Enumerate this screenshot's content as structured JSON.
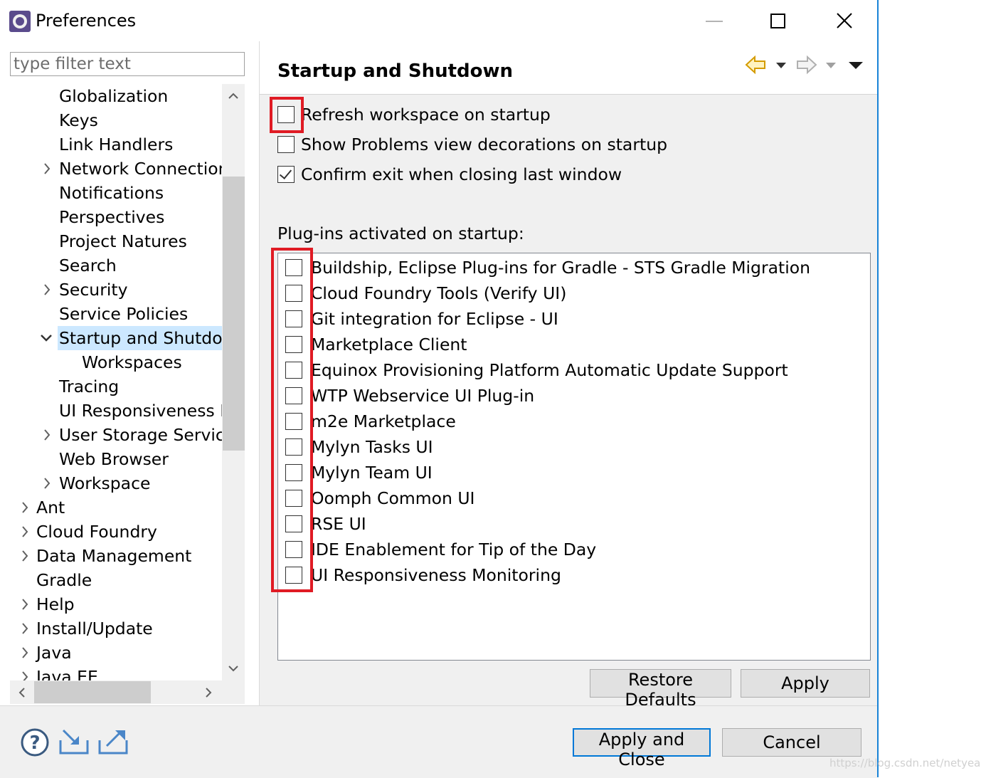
{
  "window": {
    "title": "Preferences",
    "minimize_icon": "minimize-icon",
    "maximize_icon": "maximize-icon",
    "close_icon": "close-icon"
  },
  "filter": {
    "placeholder": "type filter text",
    "value": ""
  },
  "tree": {
    "items": [
      {
        "label": "Globalization",
        "level": 1,
        "expander": "none"
      },
      {
        "label": "Keys",
        "level": 1,
        "expander": "none"
      },
      {
        "label": "Link Handlers",
        "level": 1,
        "expander": "none"
      },
      {
        "label": "Network Connection",
        "level": 1,
        "expander": "collapsed"
      },
      {
        "label": "Notifications",
        "level": 1,
        "expander": "none"
      },
      {
        "label": "Perspectives",
        "level": 1,
        "expander": "none"
      },
      {
        "label": "Project Natures",
        "level": 1,
        "expander": "none"
      },
      {
        "label": "Search",
        "level": 1,
        "expander": "none"
      },
      {
        "label": "Security",
        "level": 1,
        "expander": "collapsed"
      },
      {
        "label": "Service Policies",
        "level": 1,
        "expander": "none"
      },
      {
        "label": "Startup and Shutdown",
        "level": 1,
        "expander": "expanded",
        "selected": true
      },
      {
        "label": "Workspaces",
        "level": 2,
        "expander": "none"
      },
      {
        "label": "Tracing",
        "level": 1,
        "expander": "none"
      },
      {
        "label": "UI Responsiveness M",
        "level": 1,
        "expander": "none"
      },
      {
        "label": "User Storage Service",
        "level": 1,
        "expander": "collapsed"
      },
      {
        "label": "Web Browser",
        "level": 1,
        "expander": "none"
      },
      {
        "label": "Workspace",
        "level": 1,
        "expander": "collapsed"
      },
      {
        "label": "Ant",
        "level": 0,
        "expander": "collapsed"
      },
      {
        "label": "Cloud Foundry",
        "level": 0,
        "expander": "collapsed"
      },
      {
        "label": "Data Management",
        "level": 0,
        "expander": "collapsed"
      },
      {
        "label": "Gradle",
        "level": 0,
        "expander": "none"
      },
      {
        "label": "Help",
        "level": 0,
        "expander": "collapsed"
      },
      {
        "label": "Install/Update",
        "level": 0,
        "expander": "collapsed"
      },
      {
        "label": "Java",
        "level": 0,
        "expander": "collapsed"
      },
      {
        "label": "Java EE",
        "level": 0,
        "expander": "collapsed"
      }
    ]
  },
  "page": {
    "title": "Startup and Shutdown",
    "back_icon": "back-arrow-icon",
    "forward_icon": "forward-arrow-icon",
    "menu_icon": "view-menu-icon",
    "options": [
      {
        "label": "Refresh workspace on startup",
        "checked": false
      },
      {
        "label": "Show Problems view decorations on startup",
        "checked": false
      },
      {
        "label": "Confirm exit when closing last window",
        "checked": true
      }
    ],
    "plugins_label": "Plug-ins activated on startup:",
    "plugins": [
      {
        "label": "Buildship, Eclipse Plug-ins for Gradle - STS Gradle Migration",
        "checked": false
      },
      {
        "label": "Cloud Foundry Tools (Verify UI)",
        "checked": false
      },
      {
        "label": "Git integration for Eclipse - UI",
        "checked": false
      },
      {
        "label": "Marketplace Client",
        "checked": false
      },
      {
        "label": "Equinox Provisioning Platform Automatic Update Support",
        "checked": false
      },
      {
        "label": "WTP Webservice UI Plug-in",
        "checked": false
      },
      {
        "label": "m2e Marketplace",
        "checked": false
      },
      {
        "label": "Mylyn Tasks UI",
        "checked": false
      },
      {
        "label": "Mylyn Team UI",
        "checked": false
      },
      {
        "label": "Oomph Common UI",
        "checked": false
      },
      {
        "label": "RSE UI",
        "checked": false
      },
      {
        "label": "IDE Enablement for Tip of the Day",
        "checked": false
      },
      {
        "label": "UI Responsiveness Monitoring",
        "checked": false
      }
    ],
    "restore_defaults_label": "Restore Defaults",
    "apply_label": "Apply"
  },
  "footer": {
    "help_icon": "help-icon",
    "import_icon": "import-icon",
    "export_icon": "export-icon",
    "apply_close_label": "Apply and Close",
    "cancel_label": "Cancel"
  },
  "watermark": "https://blog.csdn.net/netyeaxi",
  "colors": {
    "highlight": "#e01b24",
    "selection": "#cce8ff",
    "primary_border": "#0078d7",
    "nav_arrow": "#e0a800"
  }
}
